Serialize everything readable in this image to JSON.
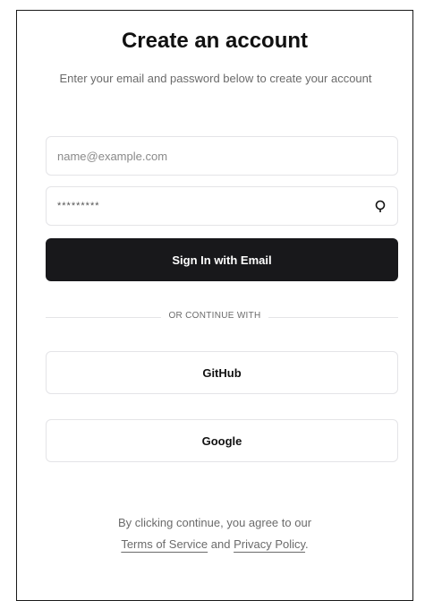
{
  "header": {
    "title": "Create an account",
    "subtitle": "Enter your email and password below to create your account"
  },
  "form": {
    "email_placeholder": "name@example.com",
    "password_value": "*********",
    "submit_label": "Sign In with Email"
  },
  "divider": {
    "label": "OR CONTINUE WITH"
  },
  "providers": {
    "github_label": "GitHub",
    "google_label": "Google"
  },
  "legal": {
    "prefix": "By clicking continue, you agree to our",
    "terms_link": "Terms of Service",
    "conjunction": "and",
    "privacy_link": "Privacy Policy",
    "suffix": "."
  },
  "icons": {
    "password_toggle": "eye-icon"
  },
  "colors": {
    "primary": "#18181b",
    "border": "#e4e4e7",
    "muted_text": "#6b6b6b"
  }
}
